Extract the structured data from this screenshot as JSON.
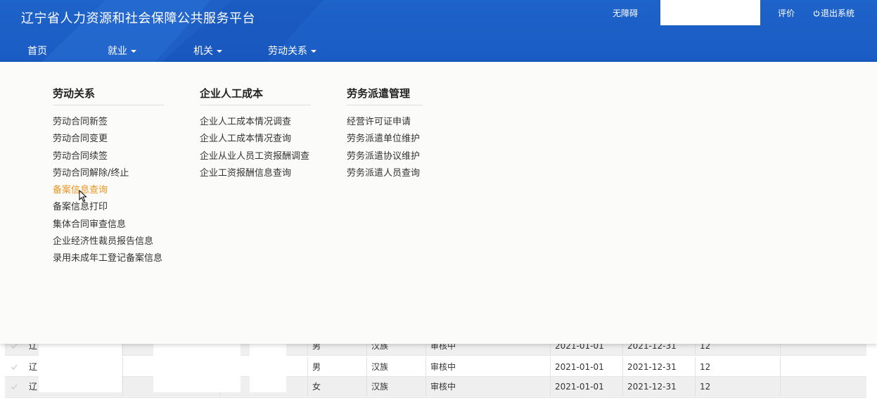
{
  "header": {
    "title": "辽宁省人力资源和社会保障公共服务平台",
    "accessibility": "无障碍",
    "search_value": "",
    "rate": "评价",
    "logout": "退出系统"
  },
  "nav": {
    "items": [
      {
        "label": "首页",
        "has_caret": false
      },
      {
        "label": "就业",
        "has_caret": true
      },
      {
        "label": "机关",
        "has_caret": true
      },
      {
        "label": "劳动关系",
        "has_caret": true
      }
    ]
  },
  "menu": {
    "columns": [
      {
        "title": "劳动关系",
        "items": [
          "劳动合同新签",
          "劳动合同变更",
          "劳动合同续签",
          "劳动合同解除/终止",
          "备案信息查询",
          "备案信息打印",
          "集体合同审查信息",
          "企业经济性裁员报告信息",
          "录用未成年工登记备案信息"
        ],
        "active_index": 4
      },
      {
        "title": "企业人工成本",
        "items": [
          "企业人工成本情况调查",
          "企业人工成本情况查询",
          "企业从业人员工资报酬调查",
          "企业工资报酬信息查询"
        ]
      },
      {
        "title": "劳务派遣管理",
        "items": [
          "经营许可证申请",
          "劳务派遣单位维护",
          "劳务派遣协议维护",
          "劳务派遣人员查询"
        ]
      }
    ]
  },
  "table": {
    "rows": [
      {
        "name": "辽",
        "gender": "男",
        "ethnicity": "汉族",
        "status": "审核中",
        "start": "2021-01-01",
        "end": "2021-12-31",
        "months": "12"
      },
      {
        "name": "辽",
        "gender": "男",
        "ethnicity": "汉族",
        "status": "审核中",
        "start": "2021-01-01",
        "end": "2021-12-31",
        "months": "12"
      },
      {
        "name": "辽",
        "gender": "女",
        "ethnicity": "汉族",
        "status": "审核中",
        "start": "2021-01-01",
        "end": "2021-12-31",
        "months": "12"
      }
    ]
  },
  "colors": {
    "header_blue": "#1e63c9",
    "active_orange": "#e8951f"
  }
}
